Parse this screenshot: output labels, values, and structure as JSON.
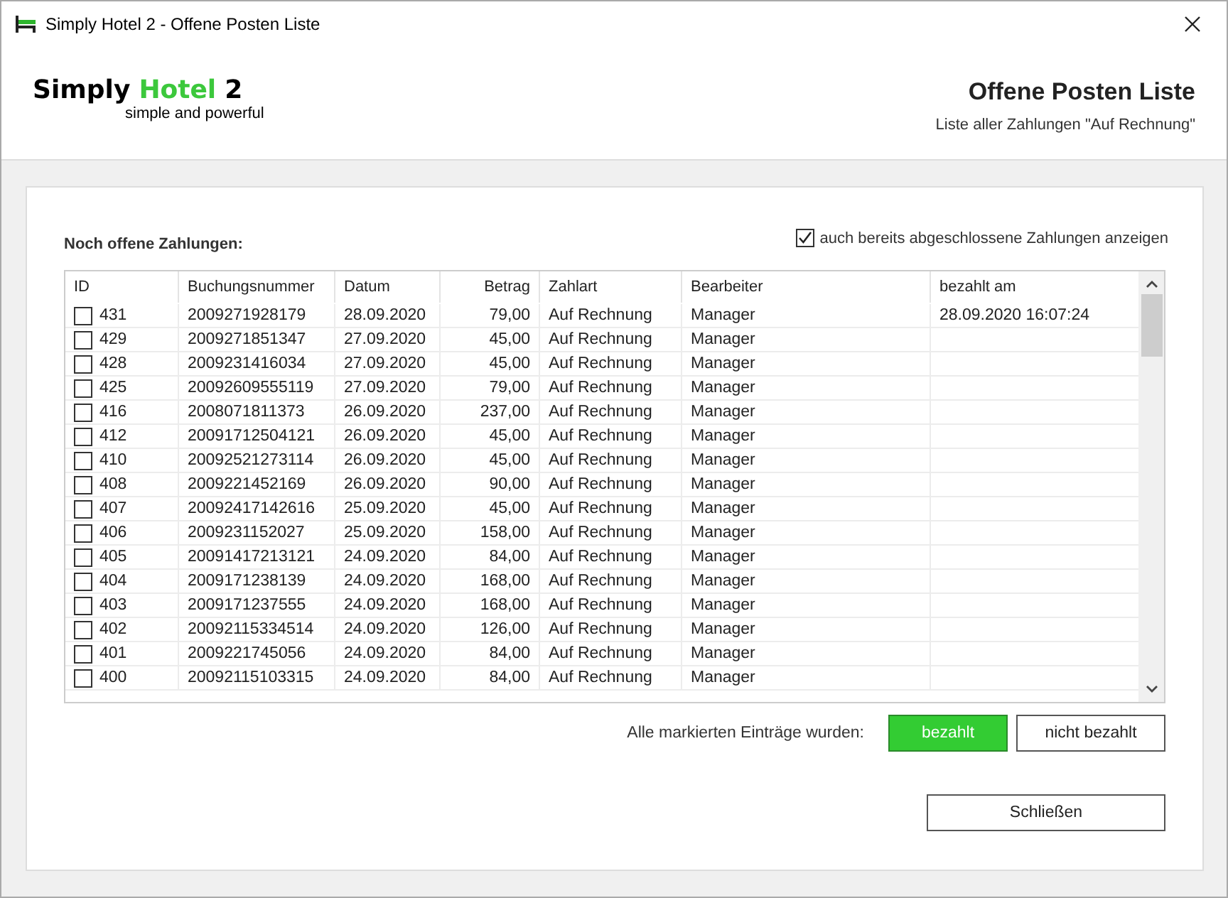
{
  "window": {
    "title": "Simply Hotel 2 - Offene Posten Liste"
  },
  "logo": {
    "word1": "Simply",
    "word2": "Hotel",
    "word3": "2",
    "tagline": "simple and powerful"
  },
  "header": {
    "title": "Offene Posten Liste",
    "subtitle": "Liste aller Zahlungen \"Auf Rechnung\""
  },
  "section_label": "Noch offene Zahlungen:",
  "show_closed": {
    "label": "auch bereits abgeschlossene Zahlungen anzeigen",
    "checked": true
  },
  "table": {
    "columns": [
      "ID",
      "Buchungsnummer",
      "Datum",
      "Betrag",
      "Zahlart",
      "Bearbeiter",
      "bezahlt am"
    ],
    "rows": [
      {
        "checked": false,
        "cells": [
          "431",
          "2009271928179",
          "28.09.2020",
          "79,00",
          "Auf Rechnung",
          "Manager",
          "28.09.2020 16:07:24"
        ]
      },
      {
        "checked": false,
        "cells": [
          "429",
          "2009271851347",
          "27.09.2020",
          "45,00",
          "Auf Rechnung",
          "Manager",
          ""
        ]
      },
      {
        "checked": false,
        "cells": [
          "428",
          "2009231416034",
          "27.09.2020",
          "45,00",
          "Auf Rechnung",
          "Manager",
          ""
        ]
      },
      {
        "checked": false,
        "cells": [
          "425",
          "20092609555119",
          "27.09.2020",
          "79,00",
          "Auf Rechnung",
          "Manager",
          ""
        ]
      },
      {
        "checked": false,
        "cells": [
          "416",
          "2008071811373",
          "26.09.2020",
          "237,00",
          "Auf Rechnung",
          "Manager",
          ""
        ]
      },
      {
        "checked": false,
        "cells": [
          "412",
          "20091712504121",
          "26.09.2020",
          "45,00",
          "Auf Rechnung",
          "Manager",
          ""
        ]
      },
      {
        "checked": false,
        "cells": [
          "410",
          "20092521273114",
          "26.09.2020",
          "45,00",
          "Auf Rechnung",
          "Manager",
          ""
        ]
      },
      {
        "checked": false,
        "cells": [
          "408",
          "2009221452169",
          "26.09.2020",
          "90,00",
          "Auf Rechnung",
          "Manager",
          ""
        ]
      },
      {
        "checked": false,
        "cells": [
          "407",
          "20092417142616",
          "25.09.2020",
          "45,00",
          "Auf Rechnung",
          "Manager",
          ""
        ]
      },
      {
        "checked": false,
        "cells": [
          "406",
          "2009231152027",
          "25.09.2020",
          "158,00",
          "Auf Rechnung",
          "Manager",
          ""
        ]
      },
      {
        "checked": false,
        "cells": [
          "405",
          "20091417213121",
          "24.09.2020",
          "84,00",
          "Auf Rechnung",
          "Manager",
          ""
        ]
      },
      {
        "checked": false,
        "cells": [
          "404",
          "2009171238139",
          "24.09.2020",
          "168,00",
          "Auf Rechnung",
          "Manager",
          ""
        ]
      },
      {
        "checked": false,
        "cells": [
          "403",
          "2009171237555",
          "24.09.2020",
          "168,00",
          "Auf Rechnung",
          "Manager",
          ""
        ]
      },
      {
        "checked": false,
        "cells": [
          "402",
          "20092115334514",
          "24.09.2020",
          "126,00",
          "Auf Rechnung",
          "Manager",
          ""
        ]
      },
      {
        "checked": false,
        "cells": [
          "401",
          "2009221745056",
          "24.09.2020",
          "84,00",
          "Auf Rechnung",
          "Manager",
          ""
        ]
      },
      {
        "checked": false,
        "cells": [
          "400",
          "20092115103315",
          "24.09.2020",
          "84,00",
          "Auf Rechnung",
          "Manager",
          ""
        ]
      }
    ]
  },
  "action_label": "Alle markierten Einträge wurden:",
  "buttons": [
    {
      "label": "bezahlt",
      "kind": "primary"
    },
    {
      "label": "nicht bezahlt",
      "kind": "secondary"
    }
  ],
  "close_button": "Schließen"
}
